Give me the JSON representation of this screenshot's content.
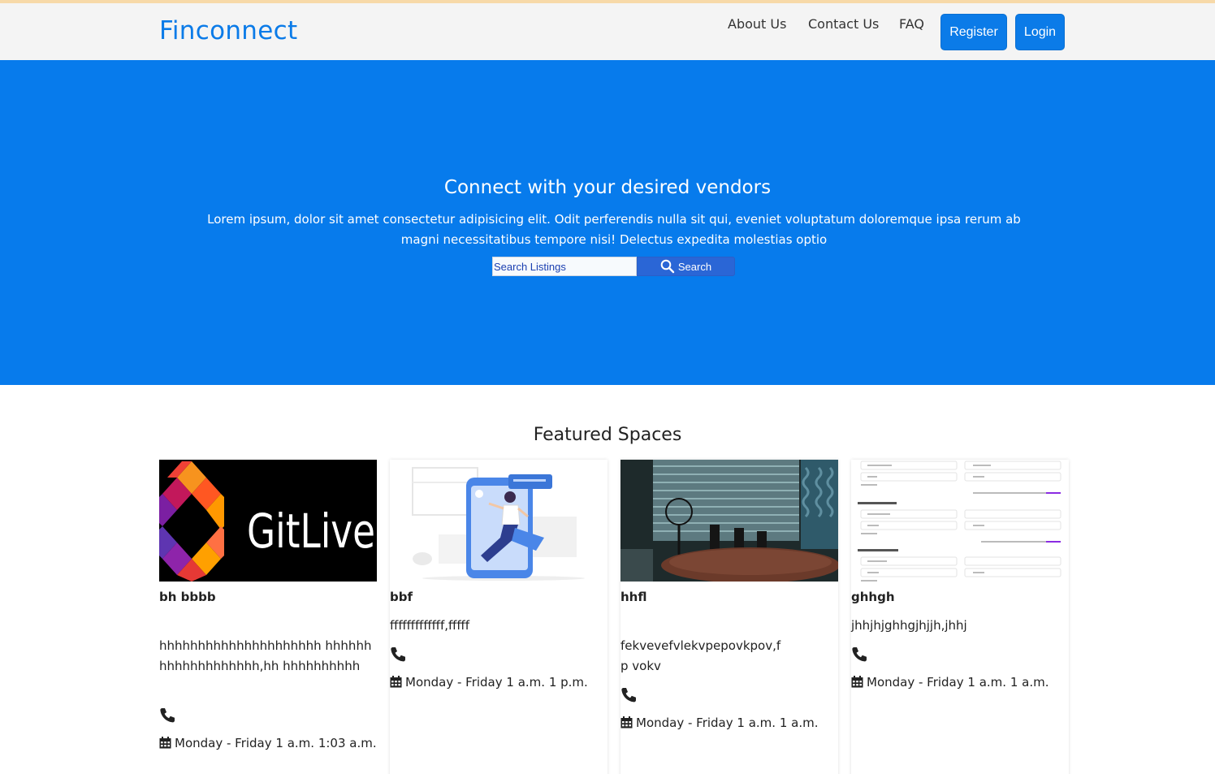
{
  "nav": {
    "brand": "Finconnect",
    "links": [
      "About Us",
      "Contact Us",
      "FAQ"
    ],
    "register_label": "Register",
    "login_label": "Login"
  },
  "hero": {
    "title": "Connect with your desired vendors",
    "subtitle": "Lorem ipsum, dolor sit amet consectetur adipisicing elit. Odit perferendis nulla sit qui, eveniet voluptatum doloremque ipsa rerum ab magni necessitatibus tempore nisi! Delectus expedita molestias optio",
    "search_placeholder": "Search Listings",
    "search_button": "Search"
  },
  "featured": {
    "title": "Featured Spaces",
    "cards": [
      {
        "name": "bh bbbb",
        "image": "GitLive",
        "description": "hhhhhhhhhhhhhhhhhhhhh hhhhhhhhhhhhhhhhhhh,hh hhhhhhhhhh",
        "hours": "Monday - Friday 1 a.m. 1:03 a.m."
      },
      {
        "name": "bbf",
        "image": "illustration",
        "description": "fffffffffffff,fffff",
        "hours": "Monday - Friday 1 a.m. 1 p.m."
      },
      {
        "name": "hhfl",
        "image": "office-photo",
        "description": "fekvevefvlekvpepovkpov,fp vokv",
        "hours": "Monday - Friday 1 a.m. 1 a.m."
      },
      {
        "name": "ghhgh",
        "image": "form-screenshot",
        "description": "jhhjhjghhgjhjjh,jhhj",
        "hours": "Monday - Friday 1 a.m. 1 a.m."
      }
    ]
  },
  "colors": {
    "primary": "#077bec",
    "brand": "#0b7be8",
    "navbar_bg": "#f4f4f4",
    "search_button": "#2a66d6"
  },
  "icons": [
    "search-icon",
    "phone-icon",
    "calendar-icon"
  ]
}
